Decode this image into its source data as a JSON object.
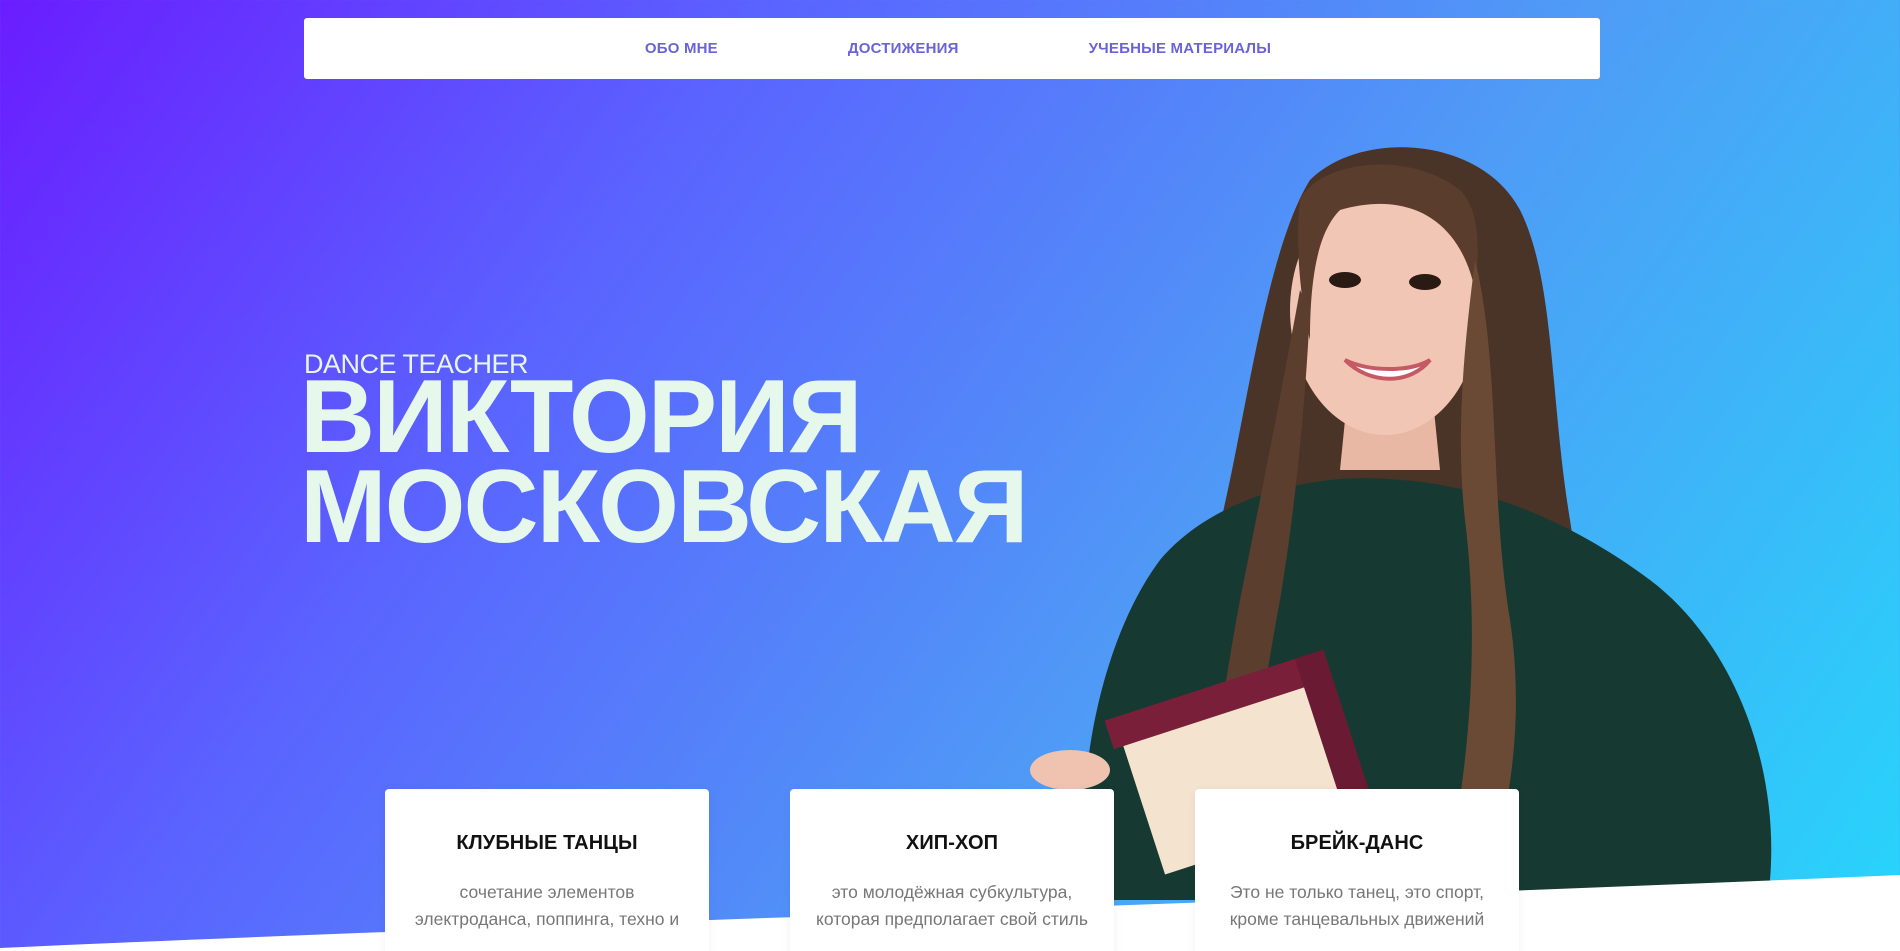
{
  "nav": {
    "items": [
      "ОБО МНЕ",
      "ДОСТИЖЕНИЯ",
      "УЧЕБНЫЕ МАТЕРИАЛЫ"
    ]
  },
  "hero": {
    "subtitle": "DANCE TEACHER",
    "name_line1": "ВИКТОРИЯ",
    "name_line2": "МОСКОВСКАЯ"
  },
  "cards": [
    {
      "title": "КЛУБНЫЕ ТАНЦЫ",
      "text": "сочетание элементов электроданса, поппинга, техно и"
    },
    {
      "title": "ХИП-ХОП",
      "text": "это молодёжная субкультура, которая предполагает свой стиль"
    },
    {
      "title": "БРЕЙК-ДАНС",
      "text": "Это не только танец, это спорт, кроме танцевальных движений"
    }
  ],
  "colors": {
    "nav_text": "#6a63d8",
    "hero_text": "#e6f8ec",
    "gradient_start": "#6a1dff",
    "gradient_end": "#26d6fb"
  }
}
